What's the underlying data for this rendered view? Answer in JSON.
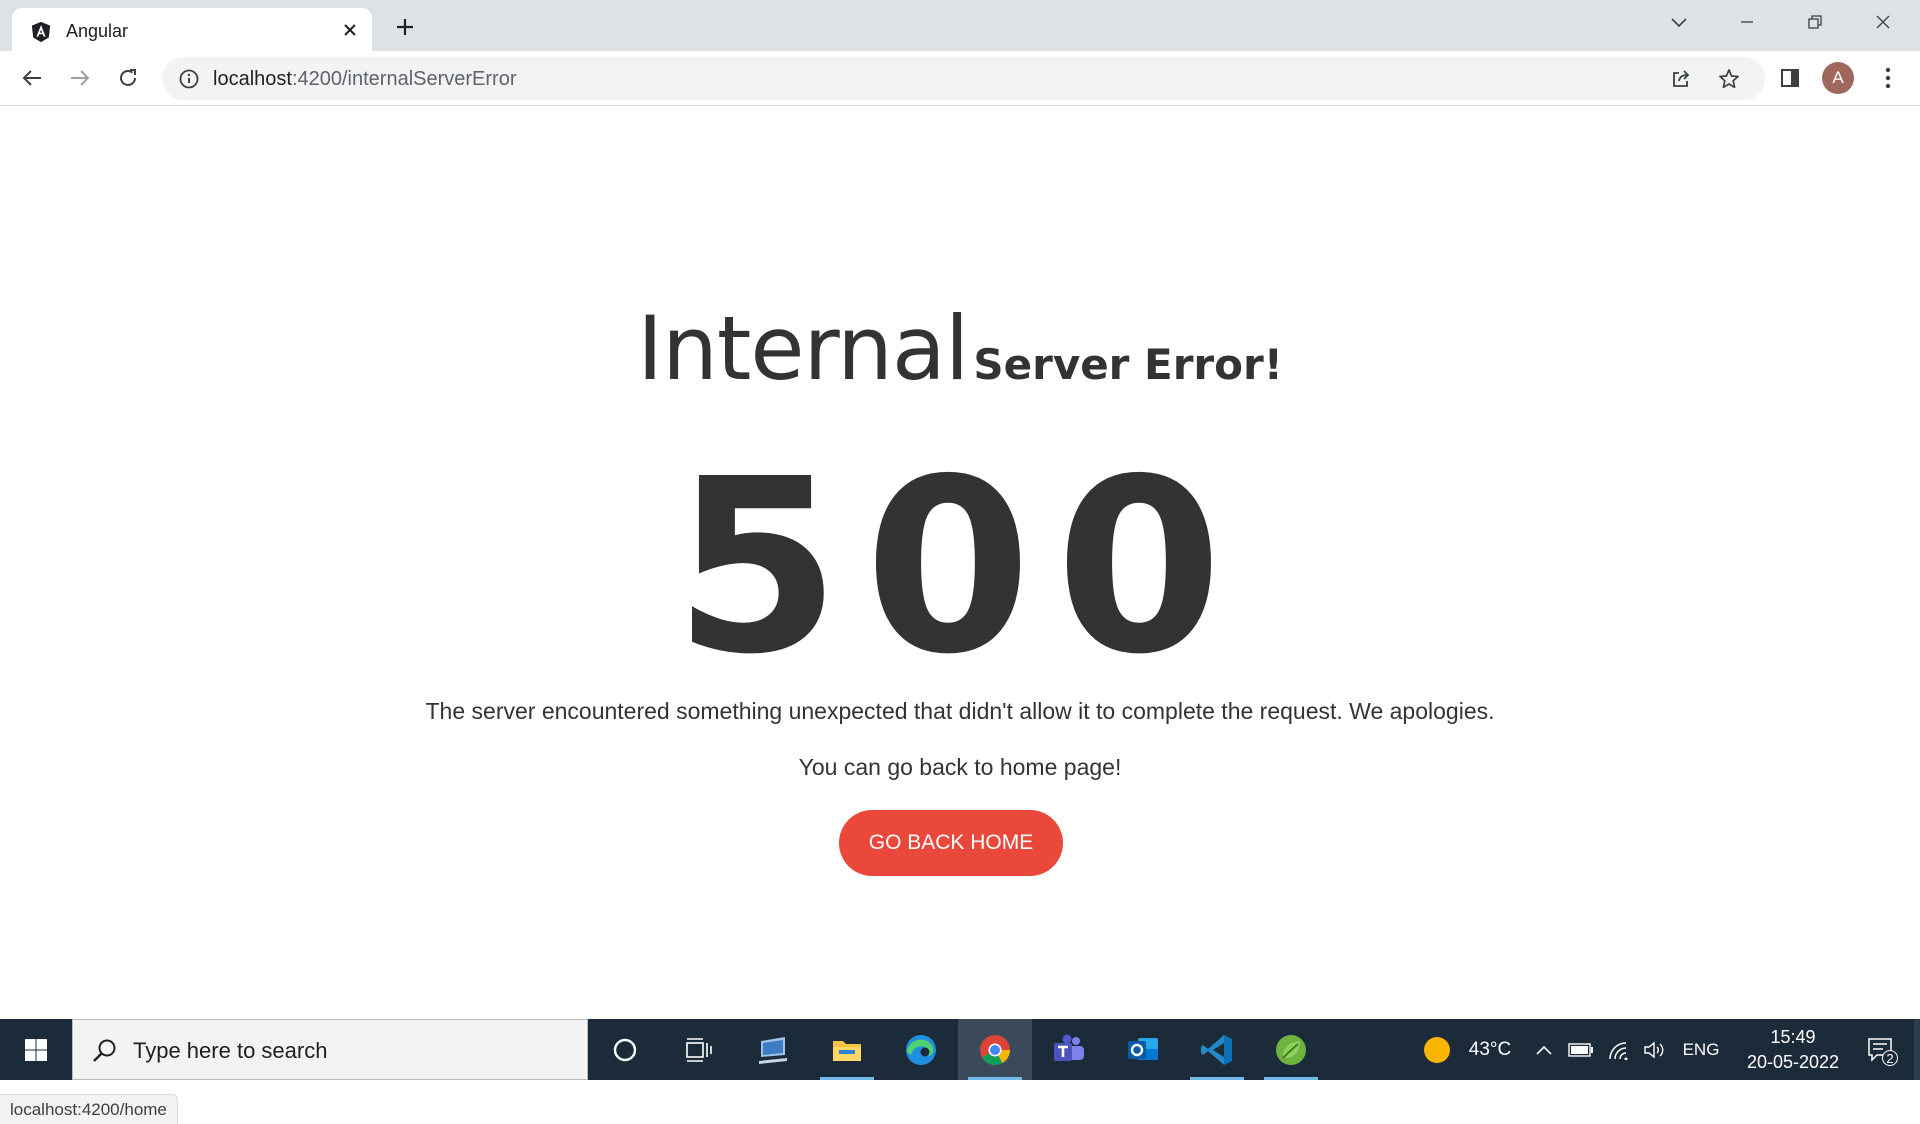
{
  "browser": {
    "tab_title": "Angular",
    "url_host": "localhost",
    "url_path": ":4200/internalServerError",
    "profile_initial": "A",
    "status_link": "localhost:4200/home"
  },
  "page": {
    "heading_big": "Internal",
    "heading_small": "Server Error!",
    "error_code": "500",
    "message": "The server encountered something unexpected that didn't allow it to complete the request. We apologies.",
    "submessage": "You can go back to home page!",
    "button_label": "GO BACK HOME",
    "button_color": "#e9483a"
  },
  "taskbar": {
    "search_placeholder": "Type here to search",
    "weather": "43°C",
    "language": "ENG",
    "time": "15:49",
    "date": "20-05-2022",
    "notification_count": "2",
    "pinned_apps": [
      "cortana",
      "task-view",
      "remote-desktop",
      "file-explorer",
      "edge",
      "chrome",
      "teams",
      "outlook",
      "vscode",
      "spring-tool-suite"
    ]
  }
}
